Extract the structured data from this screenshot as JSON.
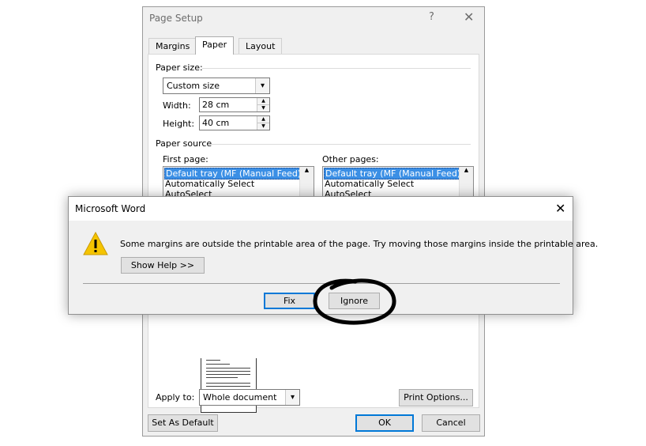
{
  "page_setup": {
    "title": "Page Setup",
    "help": "?",
    "close": "✕",
    "tabs": [
      "Margins",
      "Paper",
      "Layout"
    ],
    "paper_size_label": "Paper size:",
    "paper_size_value": "Custom size",
    "width_label": "Width:",
    "width_value": "28 cm",
    "height_label": "Height:",
    "height_value": "40 cm",
    "paper_source_label": "Paper source",
    "first_page_label": "First page:",
    "other_pages_label": "Other pages:",
    "first_page_items": [
      "Default tray (MF (Manual Feed))",
      "Automatically Select",
      "AutoSelect"
    ],
    "other_pages_items": [
      "Default tray (MF (Manual Feed))",
      "Automatically Select",
      "AutoSelect"
    ],
    "apply_to_label": "Apply to:",
    "apply_to_value": "Whole document",
    "print_options_label": "Print Options...",
    "set_as_default_label": "Set As Default",
    "ok_label": "OK",
    "cancel_label": "Cancel"
  },
  "word_alert": {
    "title": "Microsoft Word",
    "close": "✕",
    "icon": "warning-icon",
    "message": "Some margins are outside the printable area of the page. Try moving those margins inside the printable area.",
    "show_help_label": "Show Help >>",
    "fix_label": "Fix",
    "ignore_label": "Ignore"
  },
  "colors": {
    "selection": "#3b8fe5",
    "warning": "#f5c400",
    "default_border": "#0078d7"
  }
}
